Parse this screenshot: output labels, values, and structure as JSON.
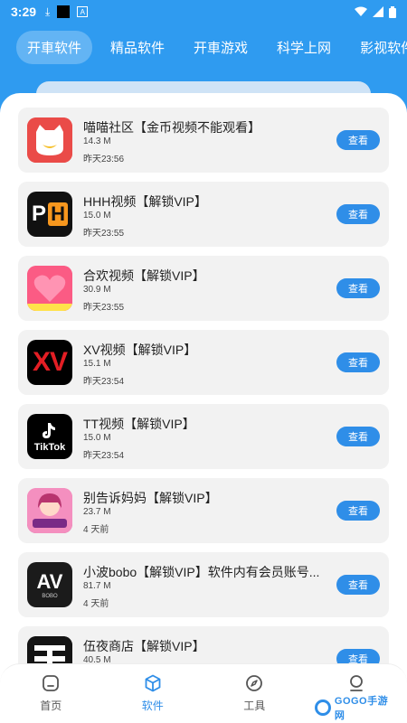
{
  "status_bar": {
    "time": "3:29"
  },
  "tabs": [
    {
      "label": "开車软件",
      "active": true
    },
    {
      "label": "精品软件",
      "active": false
    },
    {
      "label": "开車游戏",
      "active": false
    },
    {
      "label": "科学上网",
      "active": false
    },
    {
      "label": "影视软件",
      "active": false
    }
  ],
  "apps": [
    {
      "name": "喵喵社区【金币视频不能观看】",
      "size": "14.3 M",
      "date": "昨天23:56",
      "button": "查看",
      "icon": "cat-app-icon"
    },
    {
      "name": "HHH视频【解锁VIP】",
      "size": "15.0 M",
      "date": "昨天23:55",
      "button": "查看",
      "icon": "ph-app-icon",
      "icon_text_left": "P",
      "icon_text_right": "H"
    },
    {
      "name": "合欢视频【解锁VIP】",
      "size": "30.9 M",
      "date": "昨天23:55",
      "button": "查看",
      "icon": "heart-app-icon"
    },
    {
      "name": "XV视频【解锁VIP】",
      "size": "15.1 M",
      "date": "昨天23:54",
      "button": "查看",
      "icon": "xv-app-icon",
      "icon_text": "XV"
    },
    {
      "name": "TT视频【解锁VIP】",
      "size": "15.0 M",
      "date": "昨天23:54",
      "button": "查看",
      "icon": "tiktok-app-icon",
      "icon_text": "TikTok"
    },
    {
      "name": "别告诉妈妈【解锁VIP】",
      "size": "23.7 M",
      "date": "4 天前",
      "button": "查看",
      "icon": "anime-app-icon"
    },
    {
      "name": "小波bobo【解锁VIP】软件内有会员账号...",
      "size": "81.7 M",
      "date": "4 天前",
      "button": "查看",
      "icon": "av-app-icon",
      "icon_text": "AV",
      "icon_subtext": "BOBO"
    },
    {
      "name": "伍夜商店【解锁VIP】",
      "size": "40.5 M",
      "date": "",
      "button": "查看",
      "icon": "shop-app-icon"
    }
  ],
  "bottom_nav": [
    {
      "label": "首页",
      "icon": "home-icon",
      "active": false
    },
    {
      "label": "软件",
      "icon": "cube-icon",
      "active": true
    },
    {
      "label": "工具",
      "icon": "compass-icon",
      "active": false
    },
    {
      "label": "我的",
      "icon": "user-icon",
      "active": false
    }
  ],
  "watermark": {
    "text": "GOGO手游网"
  },
  "colors": {
    "accent": "#2f8ee8",
    "header": "#2f9bf0"
  }
}
